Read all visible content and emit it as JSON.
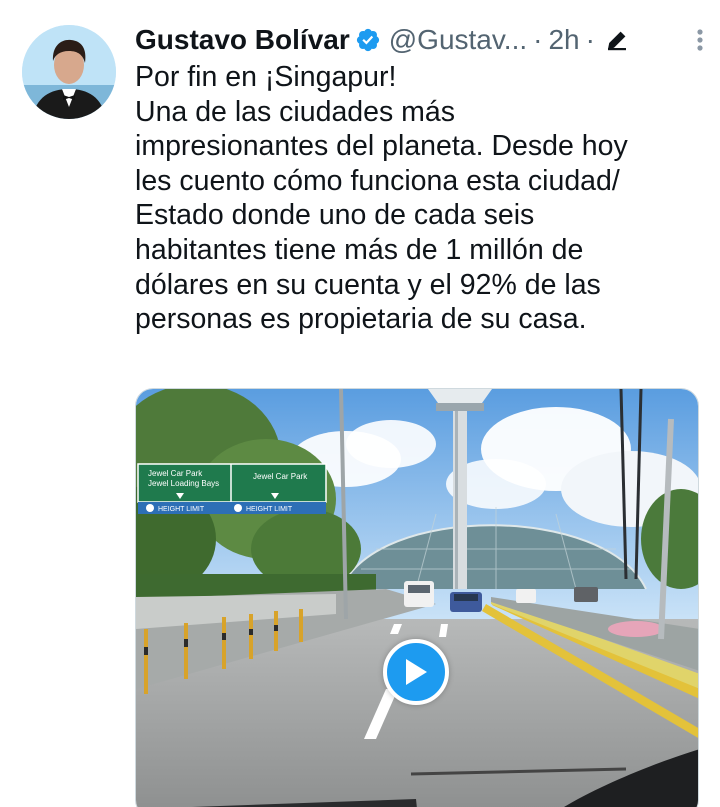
{
  "tweet": {
    "author_name": "Gustavo Bolívar",
    "handle": "@Gustav...",
    "separator": "·",
    "time": "2h",
    "text_lines": [
      "Por fin en ¡Singapur!",
      "Una de las ciudades más",
      "impresionantes del planeta. Desde hoy",
      "les cuento cómo funciona esta ciudad/",
      "Estado donde uno de cada seis",
      "habitantes tiene más de 1 millón de",
      "dólares en su cuenta y el 92% de las",
      "personas es propietaria de su casa."
    ]
  },
  "media": {
    "signs": {
      "left_line1": "Jewel Car Park",
      "left_line2": "Jewel Loading Bays",
      "right_line1": "Jewel Car Park",
      "height_limit_1": "HEIGHT LIMIT",
      "height_limit_2": "HEIGHT LIMIT"
    }
  },
  "icons": {
    "verified": "verified-badge-icon",
    "edit": "edit-pencil-icon",
    "more": "more-options-icon",
    "play": "play-icon"
  },
  "colors": {
    "accent": "#1d9bf0",
    "text": "#0f1419",
    "secondary": "#536471"
  }
}
